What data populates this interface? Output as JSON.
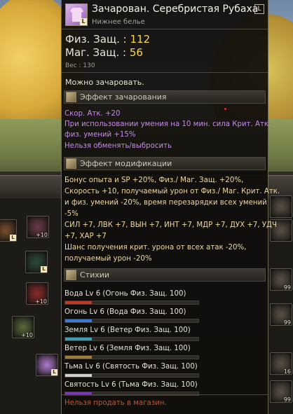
{
  "item": {
    "name": "Зачарован. Серебристая Рубаха",
    "type": "Нижнее белье",
    "grade_badge": "L",
    "icon_badge": "L",
    "icon": "shirt-icon"
  },
  "stats": {
    "pdef_label": "Физ. Защ. :",
    "pdef_value": "112",
    "mdef_label": "Маг. Защ. :",
    "mdef_value": "56",
    "weight": "Вес : 130"
  },
  "enchantable": "Можно зачаровать.",
  "enchant_section": {
    "title": "Эффект зачарования",
    "lines": [
      "Скор. Атк. +20",
      "При использовании умения на 10 мин. сила Крит. Атк.",
      "физ. умений +15%",
      "Нельзя обменять/выбросить"
    ]
  },
  "modify_section": {
    "title": "Эффект модификации",
    "lines": [
      "Бонус опыта и SP +20%, Физ./ Маг. Защ. +20%,",
      "Скорость +10, получаемый урон от Физ./ Маг. Крит. Атк.",
      "и физ. умений -20%, время перезарядки всех умений",
      "-5%",
      "СИЛ +7, ЛВК +7, ВЫН +7, ИНТ +7, МДР +7, ДУХ +7, УДЧ",
      "+7, ХАР +7",
      "Шанс получения крит. урона от всех атак -20%,",
      "получаемый урон -20%"
    ]
  },
  "elements_section": {
    "title": "Стихии",
    "items": [
      {
        "label": "Вода Lv 6 (Огонь Физ. Защ. 100)",
        "color": "#c03a2a",
        "fill": 0.2
      },
      {
        "label": "Огонь Lv 6 (Вода Физ. Защ. 100)",
        "color": "#3a7ad8",
        "fill": 0.2
      },
      {
        "label": "Земля Lv 6 (Ветер Физ. Защ. 100)",
        "color": "#3aa0b8",
        "fill": 0.2
      },
      {
        "label": "Ветер Lv 6 (Земля Физ. Защ. 100)",
        "color": "#a07a3a",
        "fill": 0.2
      },
      {
        "label": "Тьма Lv 6 (Святость Физ. Защ. 100)",
        "color": "#d0d0d0",
        "fill": 0.2
      },
      {
        "label": "Святость Lv 6 (Тьма Физ. Защ. 100)",
        "color": "#7a3ab8",
        "fill": 0.2
      }
    ]
  },
  "footer": "Нельзя продать в магазин.",
  "inventory_left": [
    {
      "count": "",
      "badge": "L",
      "color": "#7a4c2a"
    },
    {
      "count": "+10",
      "badge": "",
      "color": "#6a3a4a"
    },
    {
      "count": "",
      "badge": "L",
      "color": "#2a4a3a"
    },
    {
      "count": "+10",
      "badge": "",
      "color": "#8a2a2a"
    },
    {
      "count": "+10",
      "badge": "",
      "color": "#5a6a3a"
    },
    {
      "count": "",
      "badge": "L",
      "color": "#b07ad0"
    }
  ],
  "inventory_right": [
    {
      "count": ""
    },
    {
      "count": ""
    },
    {
      "count": "99"
    },
    {
      "count": "99"
    },
    {
      "count": "16"
    },
    {
      "count": "99"
    }
  ]
}
